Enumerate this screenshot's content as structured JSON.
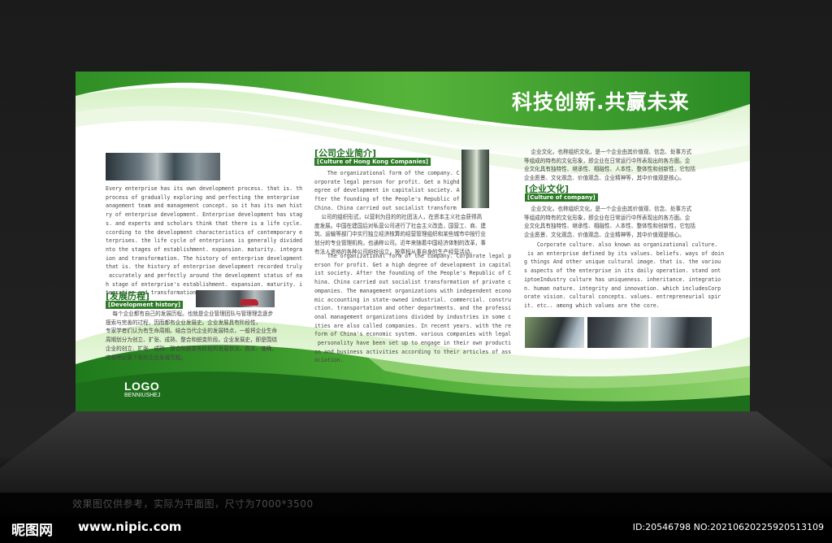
{
  "board": {
    "slogan": "科技创新.共赢未来",
    "logo": "LOGO",
    "logo_sub": "BENNIUSHEJ",
    "colors": {
      "primary_green": "#2c8a2a",
      "light_green": "#bfe6a8",
      "dark_green": "#1f6f1e"
    }
  },
  "left_column": {
    "english_text": "Every enterprise has its own development process. that is. the\nprocess of gradually exploring and perfecting the enterprise m\nanagement team and management concept. so it has its own histo\nry of enterprise development. Enterprise development has stage\ns. and experts and scholars think that there is a life cycle.A\nccording to the development characteristics of contemporary en\nterprises. the life cycle of enterprises is generally dividedi\nnto the stages of establishment. expansion. maturity. integrat\nion and transformation. The history of enterprise development.\nthat is. the history of enterprise development recorded truly.\n accurately and perfectly around the development status of eac\nh stage of enterprise's establishment. expansion. maturity. in\ntegration and transformation.",
    "heading_zh": "[发展历程]",
    "heading_en": "[Development history]",
    "chinese_text": "    每个企业都有自己的发展历程。也就是企业管理团队与管理理念逐步\n摸索与完善的过程，因而都有企业发展史。企业发展具有阶段性，\n专家学者们认为有生命周期。结合当代企业的发展特点，一般将企业生命\n周期划分为创立、扩张、成熟、整合和蜕变阶段。企业发展史，即是围绕\n企业的创立、扩张、成熟、整合和蜕变各阶段的发展状况，真实、准确、\n完善地记录下来的企业发展历程。"
  },
  "middle_column": {
    "heading_zh": "[公司企业简介]",
    "heading_en": "[Culture of Hong Kong Companies]",
    "english_top": "    The organizational form of the company. C\norporate legal person for profit. Get a highd\negree of development in capitalist society. A\nfter the founding of the People's Republic of\nChina. China carried out socialist transform",
    "chinese_text": "    公司的组织形式，以营利为目的的社团法人，在资本主义社会获得高\n度发展。中国在建国后对私营公司进行了社会主义改造，国营工、商、建\n筑、运输等部门中实行独立经济核算的经营管理组织和某些城市中按行业\n划分的专业管理机构，也通称公司。近年来随着中国经济体制的改革，事\n有法人资格的各种公司纷纷设立，按章程从事自身的生产经营活动。",
    "english_bottom": "    The organizational form of the company. Corporate legal p\nerson for profit. Get a high degree of development in capital\nist society. After the founding of the People's Republic of C\nhina. China carried out socialist transformation of private c\nompanies. The management organizations with independent econo\nmic accounting in state-owned industrial. commercial. constru\nction. transportation and other departments. and the professi\nonal management organizations divided by industries in some c\nities are also called companies. In recent years. with the re\nform of China's economic system. various companies with legal\n personality have been set up to engage in their own producti\non and business activities according to their articles of ass\nociation."
  },
  "right_column": {
    "chinese_top": "    企业文化，也称组织文化，是一个企业由其价值观、信念、处事方式\n等组成的特有的文化形象，即企业在日常运行中所表现出的各方面。企\n业文化具有独特性、继承性、相融性、人本性、整体性和创新性，它包括\n企业愿景、文化观念、价值观念、企业精神等，其中价值观是核心。",
    "heading_zh": "[企业文化]",
    "heading_en": "[Culture of company]",
    "chinese_mid": "    企业文化，也称组织文化，是一个企业由其价值观、信念、处事方式\n等组成的特有的文化形象，即企业在日常运行中所表现出的各方面。企\n业文化具有独特性、继承性、相融性、人本性、整体性和创新性，它包括\n企业愿景、文化观念、价值观念、企业精神等，其中价值观是核心。",
    "english_text": "    Corporate culture. also known as organizational culture.\n is an enterprise defined by its values. beliefs. ways of doin\ng things And other unique cultural image. that is. the variou\ns aspects of the enterprise in its daily operation. stand ont\niptoeIndustry culture has uniqueness. inheritance. integratio\nn. human nature. integrity and innovation. which includesCorp\norate vision. cultural concepts. values. entrepreneurial spir\nit. etc.. among which values are the core."
  },
  "footer": {
    "disclaimer": "效果图仅供参考，实际为平面图，尺寸为7000*3500",
    "watermark_logo": "昵图网",
    "watermark_url": "www.nipic.com",
    "watermark_id": "ID:20546798 NO:20210620225920513109"
  }
}
